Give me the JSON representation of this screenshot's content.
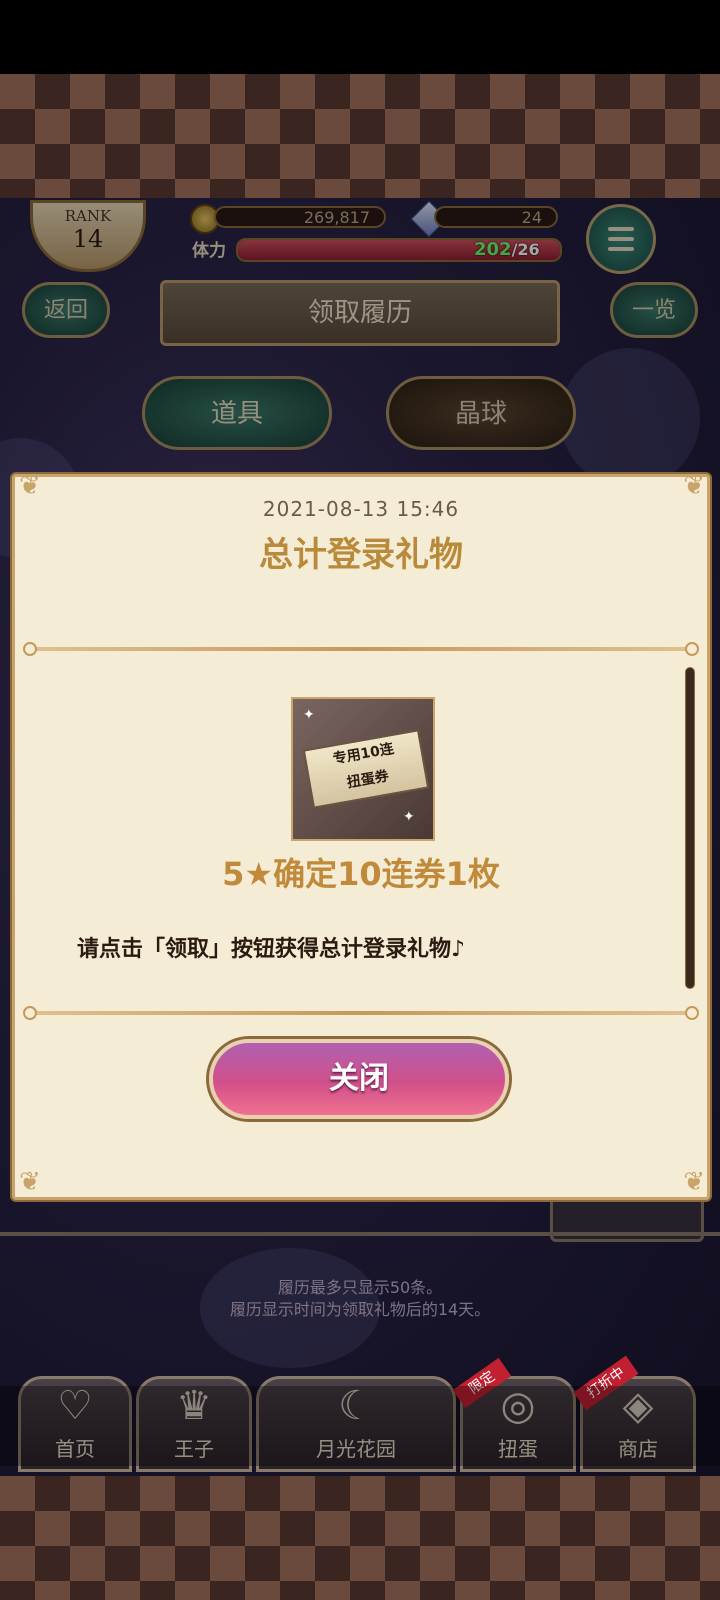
{
  "header": {
    "rank_label": "RANK",
    "rank_value": "14",
    "coins": "269,817",
    "gems": "24",
    "stamina_label": "体力",
    "stamina_current": "202",
    "stamina_max": "/26",
    "back_label": "返回",
    "title": "领取履历",
    "list_label": "一览"
  },
  "tabs": [
    {
      "label": "道具"
    },
    {
      "label": "晶球"
    }
  ],
  "dialog": {
    "date": "2021-08-13 15:46",
    "title": "总计登录礼物",
    "item_image_text_line1": "专用10连",
    "item_image_text_line2": "扭蛋券",
    "item_name": "5★确定10连券1枚",
    "description": "请点击「领取」按钮获得总计登录礼物♪",
    "close_label": "关闭"
  },
  "notes": {
    "line1": "履历最多只显示50条。",
    "line2": "履历显示时间为领取礼物后的14天。"
  },
  "nav": [
    {
      "label": "首页",
      "icon": "heart-icon"
    },
    {
      "label": "王子",
      "icon": "crown-icon"
    },
    {
      "label": "月光花园",
      "icon": "garden-icon"
    },
    {
      "label": "扭蛋",
      "icon": "gacha-icon",
      "badge": "限定"
    },
    {
      "label": "商店",
      "icon": "shop-icon",
      "badge": "打折中"
    }
  ],
  "colors": {
    "dialog_bg": "#f5ecd6",
    "title_gold": "#b88a3a",
    "close_button": "#d0508a",
    "stamina_green": "#6aff6a"
  }
}
